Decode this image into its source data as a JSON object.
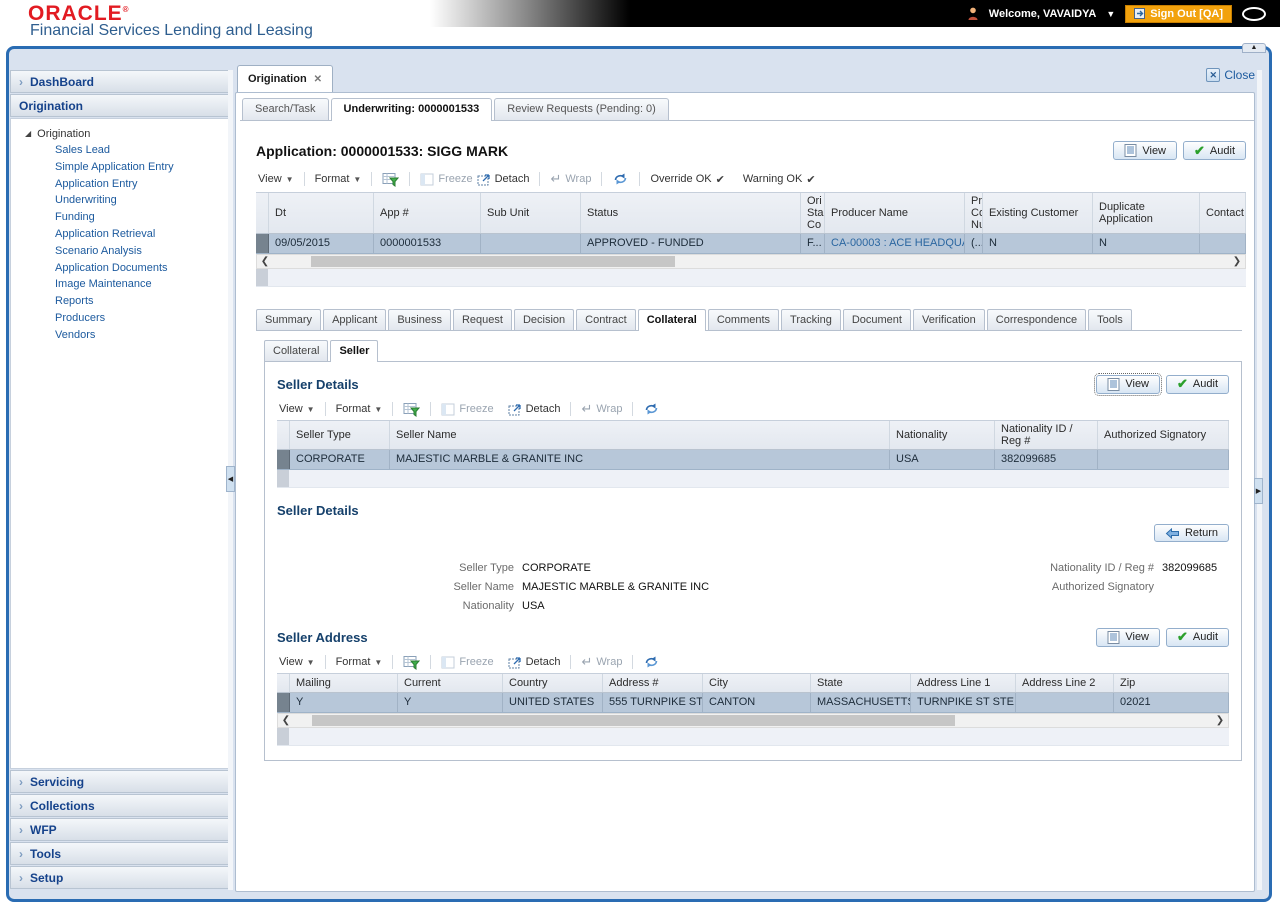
{
  "colors": {
    "frame_blue": "#2A6CB3",
    "oracle_red": "#E21B22",
    "signout_orange": "#F2A20D",
    "link_blue": "#2A66A0",
    "selected_row": "#B7C7D9",
    "title_navy": "#15406B"
  },
  "header": {
    "brand": "ORACLE",
    "product": "Financial Services Lending and Leasing",
    "welcome": "Welcome, VAVAIDYA",
    "sign_out": "Sign Out [QA]"
  },
  "window": {
    "doc_tab": "Origination",
    "close": "Close"
  },
  "sidebar": {
    "dashboard": "DashBoard",
    "origination_header": "Origination",
    "tree_root": "Origination",
    "tree_items": [
      "Sales Lead",
      "Simple Application Entry",
      "Application Entry",
      "Underwriting",
      "Funding",
      "Application Retrieval",
      "Scenario Analysis",
      "Application Documents",
      "Image Maintenance",
      "Reports",
      "Producers",
      "Vendors"
    ],
    "bottom_sections": [
      "Servicing",
      "Collections",
      "WFP",
      "Tools",
      "Setup"
    ]
  },
  "page_tabs": [
    "Search/Task",
    "Underwriting: 0000001533",
    "Review Requests (Pending: 0)"
  ],
  "application": {
    "title": "Application: 0000001533: SIGG MARK"
  },
  "toolbar": {
    "view": "View",
    "format": "Format",
    "freeze": "Freeze",
    "detach": "Detach",
    "wrap": "Wrap",
    "override_ok": "Override OK",
    "warning_ok": "Warning OK"
  },
  "buttons": {
    "view": "View",
    "audit": "Audit",
    "return": "Return"
  },
  "app_table": {
    "columns": [
      "Dt",
      "App #",
      "Sub Unit",
      "Status",
      "Ori Sta Co",
      "Producer Name",
      "Prc Co Nu",
      "Existing Customer",
      "Duplicate Application",
      "Contact"
    ],
    "row": [
      "09/05/2015",
      "0000001533",
      "",
      "APPROVED - FUNDED",
      "F...",
      "CA-00003 : ACE HEADQUA...",
      "(...",
      "N",
      "N",
      ""
    ]
  },
  "main_tabs": [
    "Summary",
    "Applicant",
    "Business",
    "Request",
    "Decision",
    "Contract",
    "Collateral",
    "Comments",
    "Tracking",
    "Document",
    "Verification",
    "Correspondence",
    "Tools"
  ],
  "sub_tabs": [
    "Collateral",
    "Seller"
  ],
  "seller_details": {
    "title": "Seller Details",
    "columns": [
      "Seller Type",
      "Seller Name",
      "Nationality",
      "Nationality ID / Reg #",
      "Authorized Signatory"
    ],
    "row": [
      "CORPORATE",
      "MAJESTIC MARBLE & GRANITE INC",
      "USA",
      "382099685",
      ""
    ]
  },
  "seller_form": {
    "title": "Seller Details",
    "fields": {
      "seller_type": {
        "label": "Seller Type",
        "value": "CORPORATE"
      },
      "seller_name": {
        "label": "Seller Name",
        "value": "MAJESTIC MARBLE & GRANITE INC"
      },
      "nationality": {
        "label": "Nationality",
        "value": "USA"
      },
      "nat_id": {
        "label": "Nationality ID / Reg #",
        "value": "382099685"
      },
      "auth_sig": {
        "label": "Authorized Signatory",
        "value": ""
      }
    }
  },
  "seller_address": {
    "title": "Seller Address",
    "columns": [
      "Mailing",
      "Current",
      "Country",
      "Address #",
      "City",
      "State",
      "Address Line 1",
      "Address Line 2",
      "Zip"
    ],
    "row": [
      "Y",
      "Y",
      "UNITED STATES",
      "555 TURNPIKE ST",
      "CANTON",
      "MASSACHUSETTS",
      "TURNPIKE ST STE...",
      "",
      "02021"
    ]
  }
}
